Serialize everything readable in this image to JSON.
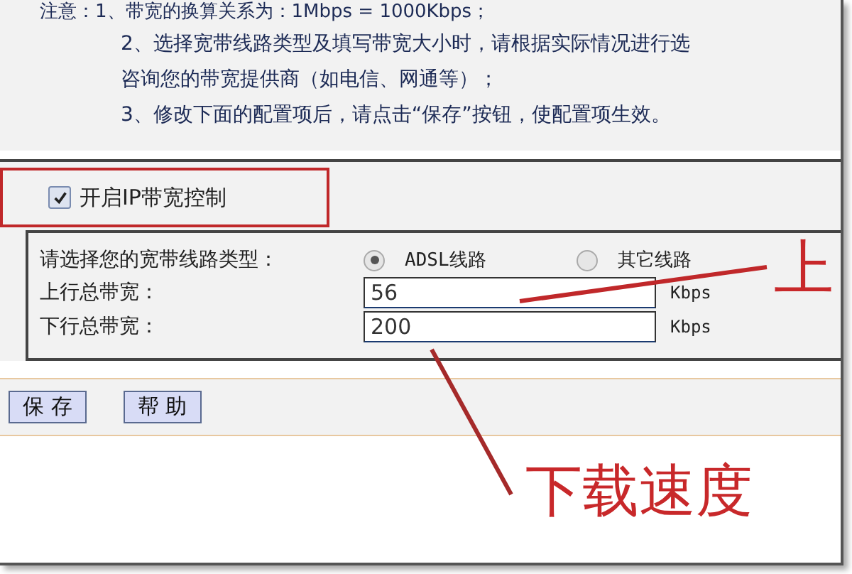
{
  "notes": [
    "注意：1、带宽的换算关系为：1Mbps = 1000Kbps；",
    "2、选择宽带线路类型及填写带宽大小时，请根据实际情况进行选",
    "咨询您的带宽提供商（如电信、网通等）；",
    "3、修改下面的配置项后，请点击“保存”按钮，使配置项生效。"
  ],
  "enable_control": {
    "label": "开启IP带宽控制",
    "checked": true
  },
  "line_type": {
    "label": "请选择您的宽带线路类型：",
    "options": [
      {
        "label": "ADSL线路",
        "selected": true
      },
      {
        "label": "其它线路",
        "selected": false
      }
    ]
  },
  "fields": [
    {
      "label": "上行总带宽：",
      "value": "56",
      "unit": "Kbps"
    },
    {
      "label": "下行总带宽：",
      "value": "200",
      "unit": "Kbps"
    }
  ],
  "buttons": [
    "保 存",
    "帮 助"
  ],
  "annotations": [
    "上",
    "下载速度"
  ]
}
